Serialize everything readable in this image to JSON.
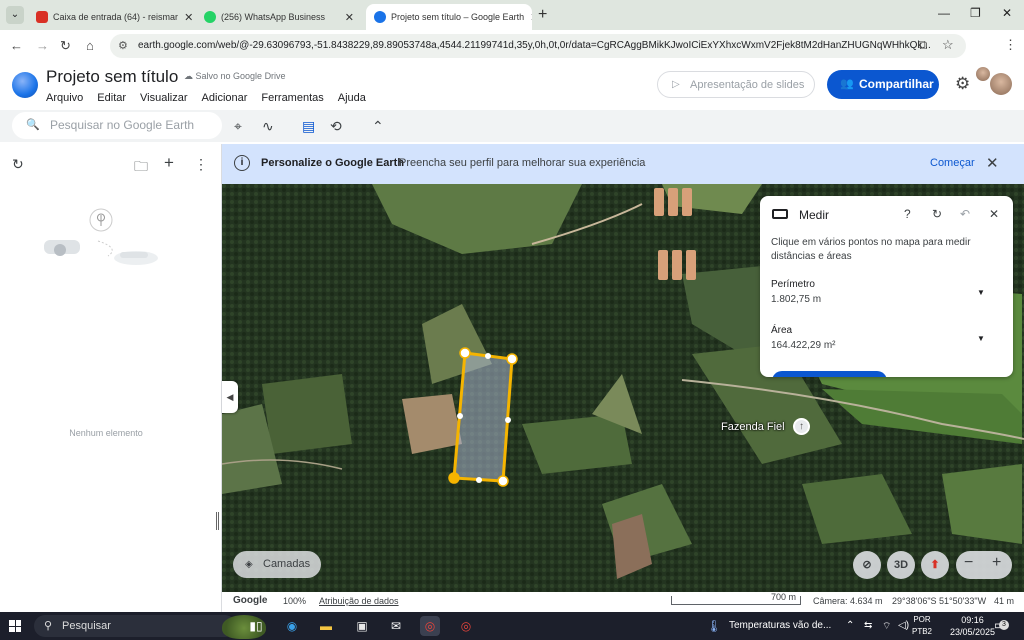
{
  "browser": {
    "tabs": [
      {
        "title": "Caixa de entrada (64) - reismar",
        "favicon_color": "#d93025"
      },
      {
        "title": "(256) WhatsApp Business",
        "favicon_color": "#25d366"
      },
      {
        "title": "Projeto sem título – Google Earth",
        "favicon_color": "#1a73e8"
      }
    ],
    "new_tab": "+",
    "url": "earth.google.com/web/@-29.63096793,-51.8438229,89.89053748a,4544.21199741d,35y,0h,0t,0r/data=CgRCAggBMikKJwoICiExYXhxcWxmV2Fjek8tM2dHanZHUGNqWHhkQk..."
  },
  "app": {
    "title": "Projeto sem título",
    "saved_status": "Salvo no Google Drive",
    "menu": [
      "Arquivo",
      "Editar",
      "Visualizar",
      "Adicionar",
      "Ferramentas",
      "Ajuda"
    ],
    "slides_label": "Apresentação de slides",
    "share_label": "Compartilhar",
    "search_placeholder": "Pesquisar no Google Earth"
  },
  "left_panel": {
    "empty_text": "Nenhum elemento"
  },
  "banner": {
    "title": "Personalize o Google Earth",
    "text": "Preencha seu perfil para melhorar sua experiência",
    "action": "Começar"
  },
  "measure": {
    "title": "Medir",
    "description": "Clique em vários pontos no mapa para medir distâncias e áreas",
    "perimeter_label": "Perímetro",
    "perimeter_value": "1.802,75 m",
    "area_label": "Área",
    "area_value": "164.422,29 m²"
  },
  "map": {
    "place_label": "Fazenda Fiel",
    "layers_label": "Camadas",
    "btn_3d": "3D",
    "zoom_out": "−",
    "zoom_in": "+"
  },
  "map_footer": {
    "brand": "Google",
    "zoom_pct": "100%",
    "attribution": "Atribuição de dados",
    "scale_label": "700 m",
    "camera": "Câmera: 4.634 m",
    "coords": "29°38'06\"S 51°50'33\"W",
    "elevation": "41 m"
  },
  "taskbar": {
    "search_label": "Pesquisar",
    "weather": "Temperaturas vão de...",
    "lang_top": "POR",
    "lang_bottom": "PTB2",
    "time": "09:16",
    "date": "23/05/2025",
    "notif_count": "3"
  },
  "colors": {
    "accent": "#0b57d0",
    "polygon_stroke": "#f5b400",
    "banner_bg": "#d3e3fd"
  }
}
